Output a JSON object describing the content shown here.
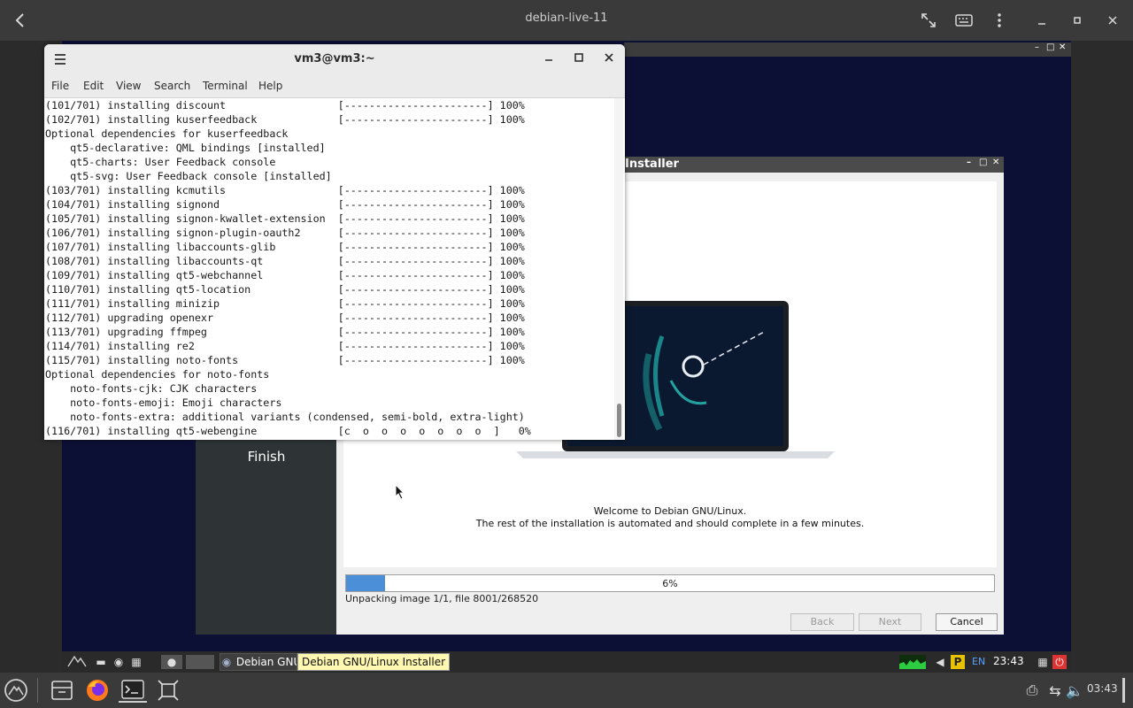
{
  "host": {
    "title": "debian-live-11",
    "clock": "03:43"
  },
  "terminal": {
    "title": "vm3@vm3:~",
    "menu": [
      "File",
      "Edit",
      "View",
      "Search",
      "Terminal",
      "Help"
    ],
    "lines": [
      "(101/701) installing discount                  [-----------------------] 100%",
      "(102/701) installing kuserfeedback             [-----------------------] 100%",
      "Optional dependencies for kuserfeedback",
      "    qt5-declarative: QML bindings [installed]",
      "    qt5-charts: User Feedback console",
      "    qt5-svg: User Feedback console [installed]",
      "(103/701) installing kcmutils                  [-----------------------] 100%",
      "(104/701) installing signond                   [-----------------------] 100%",
      "(105/701) installing signon-kwallet-extension  [-----------------------] 100%",
      "(106/701) installing signon-plugin-oauth2      [-----------------------] 100%",
      "(107/701) installing libaccounts-glib          [-----------------------] 100%",
      "(108/701) installing libaccounts-qt            [-----------------------] 100%",
      "(109/701) installing qt5-webchannel            [-----------------------] 100%",
      "(110/701) installing qt5-location              [-----------------------] 100%",
      "(111/701) installing minizip                   [-----------------------] 100%",
      "(112/701) upgrading openexr                    [-----------------------] 100%",
      "(113/701) upgrading ffmpeg                     [-----------------------] 100%",
      "(114/701) installing re2                       [-----------------------] 100%",
      "(115/701) installing noto-fonts                [-----------------------] 100%",
      "Optional dependencies for noto-fonts",
      "    noto-fonts-cjk: CJK characters",
      "    noto-fonts-emoji: Emoji characters",
      "    noto-fonts-extra: additional variants (condensed, semi-bold, extra-light)",
      "(116/701) installing qt5-webengine             [c  o  o  o  o  o  o  o  ]   0%"
    ]
  },
  "installer": {
    "title": "Installer",
    "sidebar_current": "Finish",
    "welcome_line1": "Welcome to Debian GNU/Linux.",
    "welcome_line2": "The rest of the installation is automated and should complete in a few minutes.",
    "progress_fraction": 0.06,
    "progress_label": "6%",
    "status": "Unpacking image 1/1, file 8001/268520",
    "buttons": {
      "back": "Back",
      "next": "Next",
      "cancel": "Cancel"
    }
  },
  "vm_taskbar": {
    "task_label": "Debian GNU",
    "tooltip": "Debian GNU/Linux Installer",
    "lang": "EN",
    "clock": "23:43"
  },
  "colors": {
    "accent": "#4a8fd8",
    "vm_background": "#0d1035"
  }
}
